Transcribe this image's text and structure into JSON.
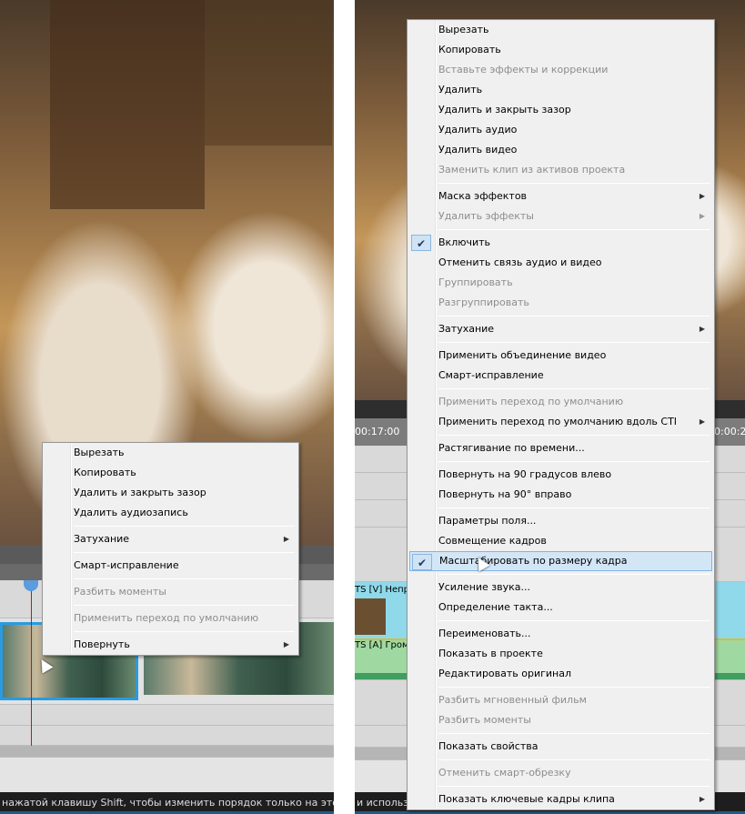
{
  "left_panel": {
    "status_text": "нажатой клавишу Shift, чтобы изменить порядок только на этой дорож",
    "menu": [
      {
        "label": "Вырезать",
        "enabled": true
      },
      {
        "label": "Копировать",
        "enabled": true
      },
      {
        "label": "Удалить и закрыть зазор",
        "enabled": true
      },
      {
        "label": "Удалить аудиозапись",
        "enabled": true
      },
      {
        "sep": true
      },
      {
        "label": "Затухание",
        "enabled": true,
        "submenu": true
      },
      {
        "sep": true
      },
      {
        "label": "Смарт-исправление",
        "enabled": true
      },
      {
        "sep": true
      },
      {
        "label": "Разбить моменты",
        "enabled": false
      },
      {
        "sep": true
      },
      {
        "label": "Применить переход по умолчанию",
        "enabled": false
      },
      {
        "sep": true
      },
      {
        "label": "Повернуть",
        "enabled": true,
        "submenu": true
      }
    ]
  },
  "right_panel": {
    "timecode_left": "00:17:00",
    "timecode_right": "0:00:2",
    "track_video_label": "TS [V] Непр",
    "track_audio_label": "TS [A] Гром",
    "status_text": "и использу",
    "menu": [
      {
        "label": "Вырезать",
        "enabled": true
      },
      {
        "label": "Копировать",
        "enabled": true
      },
      {
        "label": "Вставьте эффекты и коррекции",
        "enabled": false
      },
      {
        "label": "Удалить",
        "enabled": true
      },
      {
        "label": "Удалить и закрыть зазор",
        "enabled": true
      },
      {
        "label": "Удалить аудио",
        "enabled": true
      },
      {
        "label": "Удалить видео",
        "enabled": true
      },
      {
        "label": "Заменить клип из активов проекта",
        "enabled": false
      },
      {
        "sep": true
      },
      {
        "label": "Маска эффектов",
        "enabled": true,
        "submenu": true
      },
      {
        "label": "Удалить эффекты",
        "enabled": false,
        "submenu": true
      },
      {
        "sep": true
      },
      {
        "label": "Включить",
        "enabled": true,
        "checked": true
      },
      {
        "label": "Отменить связь аудио и видео",
        "enabled": true
      },
      {
        "label": "Группировать",
        "enabled": false
      },
      {
        "label": "Разгруппировать",
        "enabled": false
      },
      {
        "sep": true
      },
      {
        "label": "Затухание",
        "enabled": true,
        "submenu": true
      },
      {
        "sep": true
      },
      {
        "label": "Применить объединение видео",
        "enabled": true
      },
      {
        "label": "Смарт-исправление",
        "enabled": true
      },
      {
        "sep": true
      },
      {
        "label": "Применить переход по умолчанию",
        "enabled": false
      },
      {
        "label": "Применить переход по умолчанию вдоль CTI",
        "enabled": true,
        "submenu": true
      },
      {
        "sep": true
      },
      {
        "label": "Растягивание по времени...",
        "enabled": true
      },
      {
        "sep": true
      },
      {
        "label": "Повернуть на 90 градусов влево",
        "enabled": true
      },
      {
        "label": "Повернуть на 90° вправо",
        "enabled": true
      },
      {
        "sep": true
      },
      {
        "label": "Параметры поля...",
        "enabled": true
      },
      {
        "label": "Совмещение кадров",
        "enabled": true
      },
      {
        "label": "Масштабировать по размеру кадра",
        "enabled": true,
        "checked": true,
        "highlighted": true
      },
      {
        "sep": true
      },
      {
        "label": "Усиление звука...",
        "enabled": true
      },
      {
        "label": "Определение такта...",
        "enabled": true
      },
      {
        "sep": true
      },
      {
        "label": "Переименовать...",
        "enabled": true
      },
      {
        "label": "Показать в проекте",
        "enabled": true
      },
      {
        "label": "Редактировать оригинал",
        "enabled": true
      },
      {
        "sep": true
      },
      {
        "label": "Разбить мгновенный фильм",
        "enabled": false
      },
      {
        "label": "Разбить моменты",
        "enabled": false
      },
      {
        "sep": true
      },
      {
        "label": "Показать свойства",
        "enabled": true
      },
      {
        "sep": true
      },
      {
        "label": "Отменить смарт-обрезку",
        "enabled": false
      },
      {
        "sep": true
      },
      {
        "label": "Показать ключевые кадры клипа",
        "enabled": true,
        "submenu": true
      }
    ]
  },
  "icons": {
    "check": "✔",
    "submenu_arrow": "▶"
  }
}
